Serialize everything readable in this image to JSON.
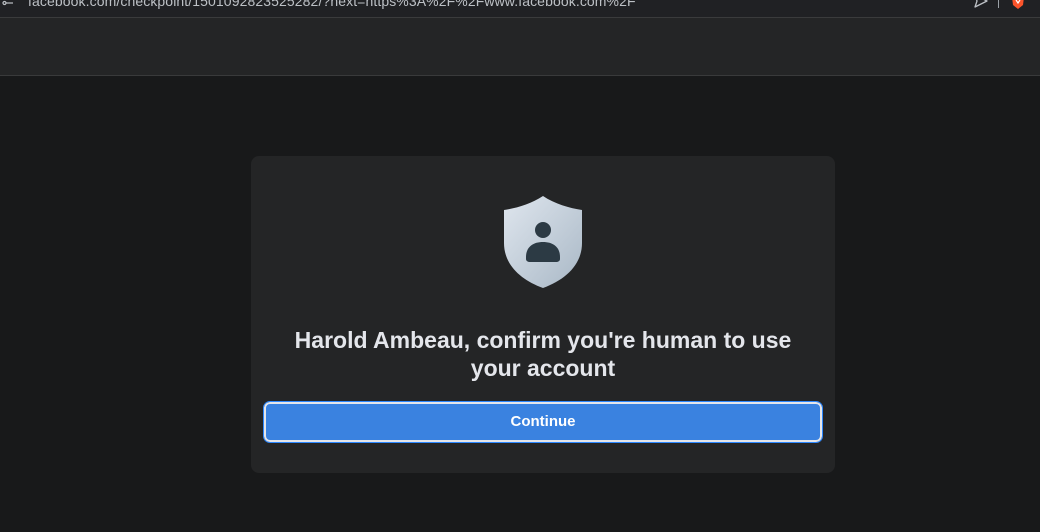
{
  "browser": {
    "url": "facebook.com/checkpoint/1501092823525282/?next=https%3A%2F%2Fwww.facebook.com%2F",
    "icons": [
      "site-settings-icon",
      "share-icon",
      "brave-shields-icon"
    ]
  },
  "checkpoint": {
    "icon": "shield-user-icon",
    "headline": "Harold Ambeau, confirm you're human to use your account",
    "continue_label": "Continue"
  },
  "colors": {
    "page_background": "#18191a",
    "card_background": "#242526",
    "primary_button": "#3a82e0",
    "headline_text": "#e4e6eb"
  }
}
